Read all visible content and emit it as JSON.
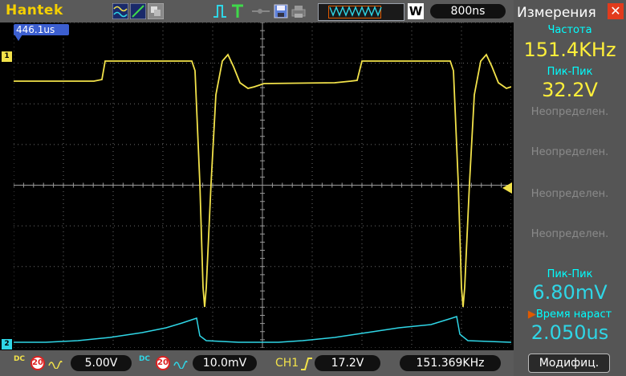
{
  "brand": "Hantek",
  "toolbar": {
    "icons": [
      "waveform-mode-icon",
      "xy-mode-icon",
      "persist-icon",
      "trigger-edge-icon",
      "trigger-t-icon",
      "probe-icon",
      "save-icon",
      "print-icon"
    ],
    "memory_mark": "W",
    "timebase": "800ns"
  },
  "plot": {
    "trigger_position": "446.1us",
    "ch1_marker": "1",
    "ch2_marker": "2"
  },
  "bottom": {
    "ch1_coupling": "DC",
    "ch1_probe": "20",
    "ch1_scale": "5.00V",
    "ch2_coupling": "DC",
    "ch2_probe": "20",
    "ch2_scale": "10.0mV",
    "trigger_source": "CH1",
    "trigger_level": "17.2V",
    "frequency": "151.369KHz"
  },
  "measurements": {
    "title": "Измерения",
    "items": [
      {
        "label": "Частота",
        "value": "151.4KHz"
      },
      {
        "label": "Пик-Пик",
        "value": "32.2V"
      },
      {
        "label": "Неопределен."
      },
      {
        "label": "Неопределен."
      },
      {
        "label": "Неопределен."
      },
      {
        "label": "Неопределен."
      },
      {
        "label": "Пик-Пик",
        "value": "6.80mV"
      },
      {
        "label": "Время нараст",
        "value": "2.050us"
      }
    ],
    "modify_label": "Модифиц."
  },
  "colors": {
    "ch1": "#f2e24a",
    "ch2": "#2fd6e6",
    "grid": "#7a7a7a",
    "panel": "#555555",
    "accent": "#e05a00"
  }
}
